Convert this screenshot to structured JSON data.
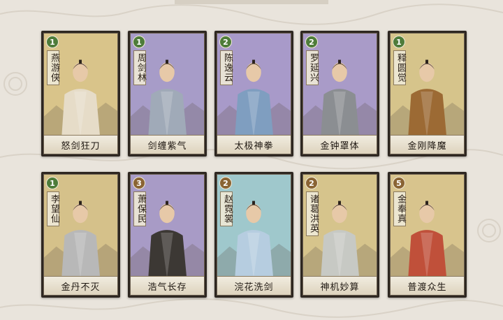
{
  "colors": {
    "background": "#e9e4dc",
    "card_border": "#2e2721",
    "badge_green": "#4e7c3a",
    "badge_brown": "#8a6434"
  },
  "cards": [
    {
      "cost": "1",
      "name": "燕游侠",
      "skill": "怒剑狂刀",
      "bg": "#d9c48a",
      "robe": "#e6dcc8",
      "badge": "#4e7c3a"
    },
    {
      "cost": "1",
      "name": "周剑林",
      "skill": "剑缠紫气",
      "bg": "#a79cc8",
      "robe": "#a0aab8",
      "badge": "#4e7c3a"
    },
    {
      "cost": "2",
      "name": "陈逸云",
      "skill": "太极神拳",
      "bg": "#a89ac9",
      "robe": "#7f9ec0",
      "badge": "#4e7c3a"
    },
    {
      "cost": "2",
      "name": "罗延兴",
      "skill": "金钟罩体",
      "bg": "#a99bc8",
      "robe": "#8b8e92",
      "badge": "#4e7c3a"
    },
    {
      "cost": "1",
      "name": "释圆觉",
      "skill": "金刚降魔",
      "bg": "#d6c48b",
      "robe": "#9c6a34",
      "badge": "#4e7c3a"
    },
    {
      "cost": "1",
      "name": "李望仙",
      "skill": "金丹不灭",
      "bg": "#d5c18a",
      "robe": "#b8b8b8",
      "badge": "#4e7c3a"
    },
    {
      "cost": "3",
      "name": "萧保民",
      "skill": "浩气长存",
      "bg": "#a89bc6",
      "robe": "#3c3834",
      "badge": "#8a6434"
    },
    {
      "cost": "2",
      "name": "赵霓裳",
      "skill": "浣花洗剑",
      "bg": "#9fc8cc",
      "robe": "#b6cde0",
      "badge": "#8a6434"
    },
    {
      "cost": "2",
      "name": "诸葛洪英",
      "skill": "神机妙算",
      "bg": "#d6c48c",
      "robe": "#c7c9c4",
      "badge": "#8a6434"
    },
    {
      "cost": "5",
      "name": "金奉真",
      "skill": "普渡众生",
      "bg": "#d8c48d",
      "robe": "#c0503a",
      "badge": "#8a6434"
    }
  ]
}
